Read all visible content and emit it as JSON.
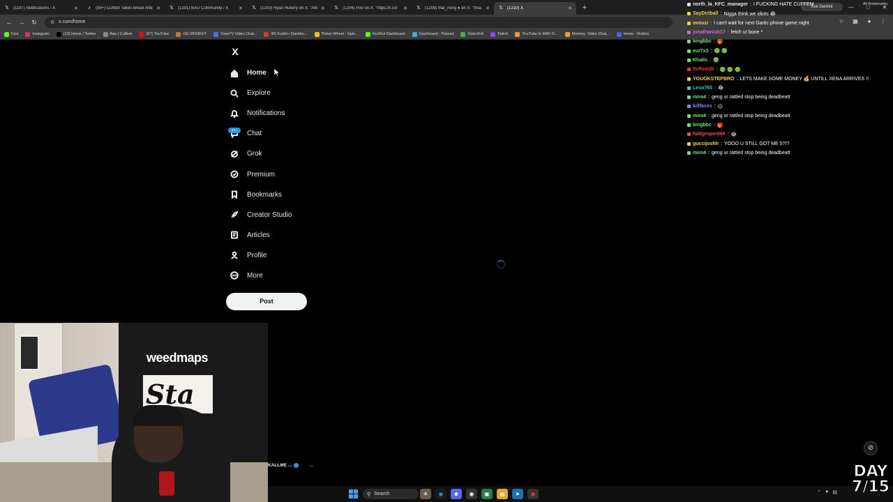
{
  "browser": {
    "tabs": [
      {
        "title": "(1197) Notifications / X",
        "favicon": "x-icon",
        "active": false
      },
      {
        "title": "(99+) Cuffem Takes Break After",
        "favicon": "tiktok-icon",
        "active": false
      },
      {
        "title": "(1201) BAU Community / X",
        "favicon": "x-icon",
        "active": false
      },
      {
        "title": "(1203) Ryan Hukery on X: \"After",
        "favicon": "x-icon",
        "active": false
      },
      {
        "title": "(1204) Poo on X: \"https://t.co/",
        "favicon": "x-icon",
        "active": false
      },
      {
        "title": "(1209) thai_ming ● on X: \"Insa",
        "favicon": "x-icon",
        "active": false
      },
      {
        "title": "(1210) X",
        "favicon": "x-icon",
        "active": true
      }
    ],
    "url": "x.com/home",
    "bookmarks": [
      {
        "label": "Kick",
        "color": "#53fc18"
      },
      {
        "label": "Instagram",
        "color": "#e1306c"
      },
      {
        "label": "(12) Home / Twitter",
        "color": "#000000"
      },
      {
        "label": "Bau | Cuffem",
        "color": "#888888"
      },
      {
        "label": "(57) YouTube",
        "color": "#ff0000"
      },
      {
        "label": "OG MONKEY",
        "color": "#c47a2c"
      },
      {
        "label": "OmeTV Video Chat...",
        "color": "#4a6cff"
      },
      {
        "label": "IRLToolkit • Dashbo...",
        "color": "#d23b3b"
      },
      {
        "label": "Picker Wheel - Spin...",
        "color": "#f4c20d"
      },
      {
        "label": "KickBot Dashboard",
        "color": "#53fc18"
      },
      {
        "label": "Dashboard - Pulsoid",
        "color": "#2fb6d6"
      },
      {
        "label": "DistroKid",
        "color": "#4caf50"
      },
      {
        "label": "Twitch",
        "color": "#9146ff"
      },
      {
        "label": "YouTube to WAV D...",
        "color": "#e0a030"
      },
      {
        "label": "Monkey: Video Chat...",
        "color": "#f0a020"
      },
      {
        "label": "Home - Roblox",
        "color": "#3a6cf0"
      }
    ],
    "all_bookmarks": "All Bookmarks",
    "ask_gemini": "Ask Gemini"
  },
  "sidebar": {
    "logo": "X",
    "items": [
      {
        "label": "Home",
        "icon": "home-icon",
        "active": true
      },
      {
        "label": "Explore",
        "icon": "search-icon",
        "active": false
      },
      {
        "label": "Notifications",
        "icon": "bell-icon",
        "active": false
      },
      {
        "label": "Chat",
        "icon": "chat-icon",
        "active": false
      },
      {
        "label": "Grok",
        "icon": "grok-icon",
        "active": false
      },
      {
        "label": "Premium",
        "icon": "premium-icon",
        "active": false
      },
      {
        "label": "Bookmarks",
        "icon": "bookmark-icon",
        "active": false
      },
      {
        "label": "Creator Studio",
        "icon": "rocket-icon",
        "active": false
      },
      {
        "label": "Articles",
        "icon": "article-icon",
        "active": false
      },
      {
        "label": "Profile",
        "icon": "profile-icon",
        "active": false
      },
      {
        "label": "More",
        "icon": "more-icon",
        "active": false
      }
    ],
    "chat_badge": "20+",
    "post_label": "Post"
  },
  "account_snippet": {
    "name": "KALLME ...",
    "more": "..."
  },
  "chat": [
    {
      "user": "north_la_KFC_manager",
      "msg": "I FUCKING HATE CUFFEM",
      "color": "#e7e9ea"
    },
    {
      "user": "SayDirtball",
      "msg": "Nigga think we idiots 😂",
      "color": "#f5d442"
    },
    {
      "user": "ovouzi",
      "msg": "I can't wait for next Gartic phone game night",
      "color": "#f5d442"
    },
    {
      "user": "jonathanisk17",
      "msg": "fetch ur bone *",
      "color": "#c86dd7"
    },
    {
      "user": "kingbbc",
      "msg": "🎁",
      "color": "#6fe86f"
    },
    {
      "user": "eur7x3",
      "msg": "🟢 🟢",
      "color": "#6fe86f"
    },
    {
      "user": "Khalis",
      "msg": "🟢",
      "color": "#6fe86f"
    },
    {
      "user": "ItsReal2k",
      "msg": "🟢 🟢 🟢",
      "color": "#e53935"
    },
    {
      "user": "YOUOKSTEPBRO",
      "msg": "LETS MAKE SOME MONEY 💰 UNTILL XENA ARRIVES !!",
      "color": "#f5d442"
    },
    {
      "user": "Leso765",
      "msg": "😂",
      "color": "#3fc9c9"
    },
    {
      "user": "miro4",
      "msg": "geng ur rattled stop being deadbeatt",
      "color": "#6fe86f"
    },
    {
      "user": "killfaces",
      "msg": "😑",
      "color": "#8a8aff"
    },
    {
      "user": "miro4",
      "msg": "geng ur rattled stop being deadbeatt",
      "color": "#6fe86f"
    },
    {
      "user": "kingbbc",
      "msg": "🎁",
      "color": "#6fe86f"
    },
    {
      "user": "foldgroper666",
      "msg": "😂",
      "color": "#e05050"
    },
    {
      "user": "guccijoshh",
      "msg": "YOOO U STILL GOT ME 5?!?",
      "color": "#f5d442"
    },
    {
      "user": "miro4",
      "msg": "geng ur rattled stop being deadbeatt",
      "color": "#6fe86f"
    }
  ],
  "webcam": {
    "banner_brand": "weedmaps",
    "banner_word": "Sta"
  },
  "taskbar": {
    "search_placeholder": "Search"
  },
  "overlay": {
    "day_label": "DAY",
    "day_count": "7/15"
  },
  "colors": {
    "accent": "#1d9bf0",
    "background": "#000000",
    "post_button": "#eff3f4"
  }
}
